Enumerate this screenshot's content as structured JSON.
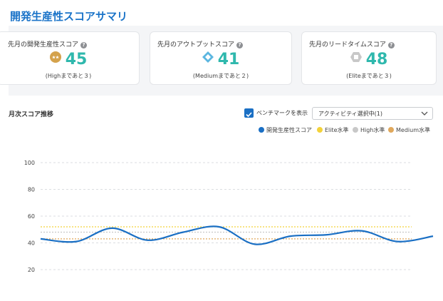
{
  "header": {
    "title": "開発生産性スコアサマリ"
  },
  "cards": [
    {
      "label": "先月の開発生産性スコア",
      "value": "45",
      "hint": "(Highまであと３)",
      "badge_icon": "high-badge-icon",
      "badge_color": "#d4a24c"
    },
    {
      "label": "先月のアウトプットスコア",
      "value": "41",
      "hint": "(Mediumまであと２)",
      "badge_icon": "medium-diamond-badge-icon",
      "badge_color": "#5bb6e0"
    },
    {
      "label": "先月のリードタイムスコア",
      "value": "48",
      "hint": "(Eliteまであと３)",
      "badge_icon": "elite-badge-icon",
      "badge_color": "#c8c8c8"
    }
  ],
  "trend": {
    "title": "月次スコア推移",
    "benchmark_label": "ベンチマークを表示",
    "benchmark_checked": true,
    "activity_select": "アクティビティ選択中(1)"
  },
  "colors": {
    "accent": "#1a73c8",
    "score_teal": "#2fb8ad",
    "series_blue": "#1a6fc4",
    "elite": "#f3d23a",
    "high": "#c8c8c8",
    "medium": "#e0a85c"
  },
  "chart_data": {
    "type": "line",
    "title": "",
    "xlabel": "",
    "ylabel": "",
    "ylim": [
      0,
      100
    ],
    "yticks": [
      "100",
      "80",
      "60",
      "40",
      "20"
    ],
    "grid": true,
    "legend_position": "top-right",
    "series": [
      {
        "name": "開発生産性スコア",
        "values": [
          43,
          41,
          51,
          42,
          48,
          52,
          39,
          45,
          46,
          49,
          41,
          45
        ]
      }
    ],
    "benchmarks": [
      {
        "name": "Elite水準",
        "value": 52
      },
      {
        "name": "High水準",
        "value": 48
      },
      {
        "name": "Medium水準",
        "value": 43
      }
    ]
  }
}
